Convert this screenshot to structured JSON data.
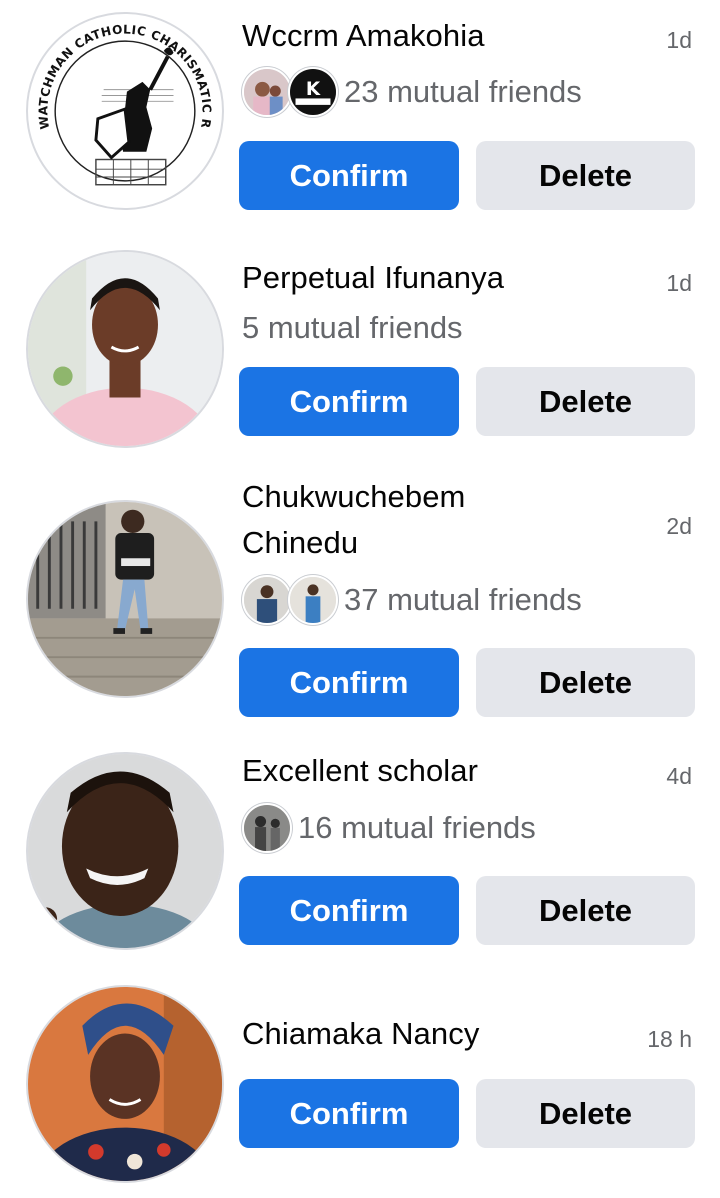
{
  "requests": [
    {
      "name": "Wccrm Amakohia",
      "time": "1d",
      "mutual": "23 mutual friends",
      "mutual_avatars": [
        "mutual-friend-photo",
        "kedism-logo"
      ],
      "avatar_logo_text": "WATCHMAN CATHOLIC CHARISMATIC RENEWAL MOVEMENT",
      "confirm_label": "Confirm",
      "delete_label": "Delete"
    },
    {
      "name": "Perpetual Ifunanya",
      "time": "1d",
      "mutual": "5 mutual friends",
      "mutual_avatars": [],
      "confirm_label": "Confirm",
      "delete_label": "Delete"
    },
    {
      "name": "Chukwuchebem\nChinedu",
      "time": "2d",
      "mutual": "37 mutual friends",
      "mutual_avatars": [
        "mutual-friend-photo",
        "mutual-friend-photo"
      ],
      "confirm_label": "Confirm",
      "delete_label": "Delete"
    },
    {
      "name": "Excellent scholar",
      "time": "4d",
      "mutual": "16 mutual friends",
      "mutual_avatars": [
        "mutual-friend-photo"
      ],
      "confirm_label": "Confirm",
      "delete_label": "Delete"
    },
    {
      "name": "Chiamaka Nancy",
      "time": "18 h",
      "mutual": "",
      "mutual_avatars": [],
      "confirm_label": "Confirm",
      "delete_label": "Delete"
    }
  ],
  "colors": {
    "confirm_bg": "#1b74e4",
    "delete_bg": "#e4e6eb",
    "secondary_text": "#65676b"
  }
}
